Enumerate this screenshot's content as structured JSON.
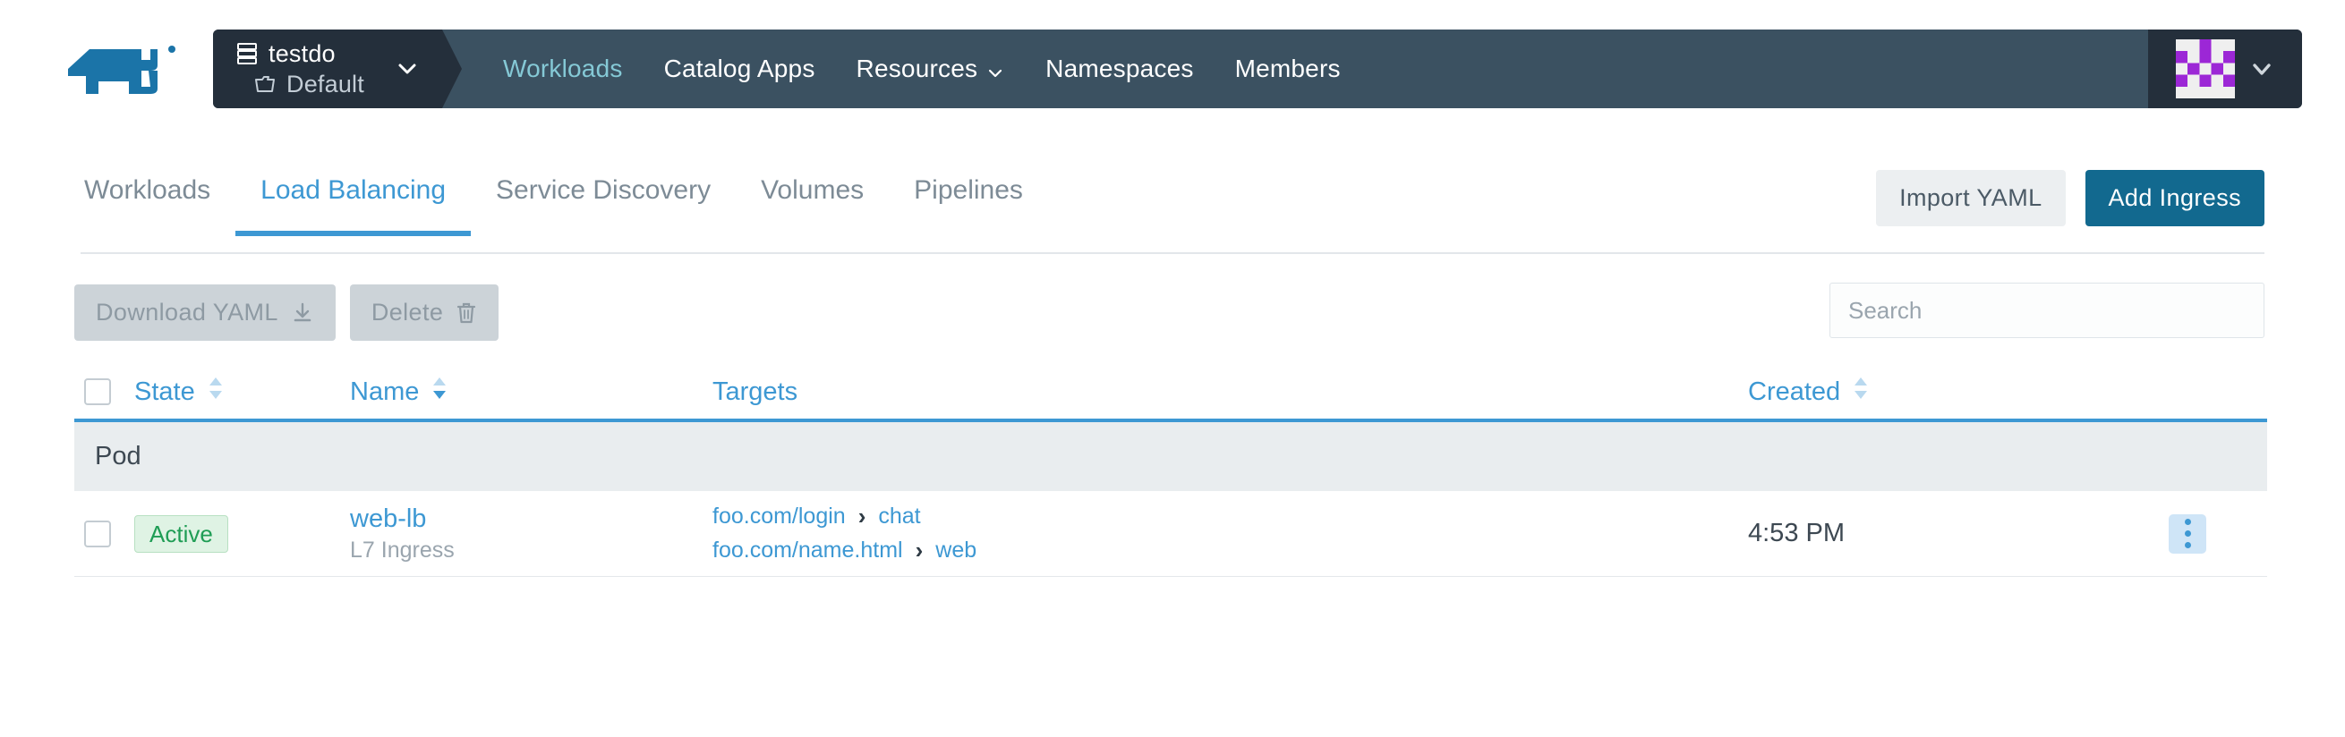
{
  "header": {
    "logo_icon": "rancher-cow-logo",
    "cluster": {
      "cluster_icon": "server-stack-icon",
      "cluster_name": "testdo",
      "project_icon": "folder-icon",
      "project_name": "Default",
      "caret_icon": "chevron-down-icon"
    },
    "nav": [
      {
        "label": "Workloads",
        "active": true,
        "has_caret": false
      },
      {
        "label": "Catalog Apps",
        "active": false,
        "has_caret": false
      },
      {
        "label": "Resources",
        "active": false,
        "has_caret": true
      },
      {
        "label": "Namespaces",
        "active": false,
        "has_caret": false
      },
      {
        "label": "Members",
        "active": false,
        "has_caret": false
      }
    ],
    "user": {
      "avatar_icon": "user-identicon-avatar",
      "caret_icon": "chevron-down-icon"
    }
  },
  "tabs": [
    {
      "label": "Workloads",
      "active": false
    },
    {
      "label": "Load Balancing",
      "active": true
    },
    {
      "label": "Service Discovery",
      "active": false
    },
    {
      "label": "Volumes",
      "active": false
    },
    {
      "label": "Pipelines",
      "active": false
    }
  ],
  "page_actions": {
    "import_yaml": "Import YAML",
    "add_ingress": "Add Ingress"
  },
  "toolbar": {
    "download_yaml": "Download YAML",
    "download_icon": "download-icon",
    "delete": "Delete",
    "delete_icon": "trash-icon",
    "search_placeholder": "Search",
    "search_value": ""
  },
  "table": {
    "columns": [
      {
        "label": "State",
        "sortable": true,
        "sort": "none"
      },
      {
        "label": "Name",
        "sortable": true,
        "sort": "desc"
      },
      {
        "label": "Targets",
        "sortable": false,
        "sort": "none"
      },
      {
        "label": "Created",
        "sortable": true,
        "sort": "none"
      }
    ],
    "group_label": "Pod",
    "rows": [
      {
        "selected": false,
        "state": "Active",
        "name": "web-lb",
        "name_sub": "L7 Ingress",
        "targets": [
          {
            "host": "foo.com/login",
            "separator": "›",
            "service": "chat"
          },
          {
            "host": "foo.com/name.html",
            "separator": "›",
            "service": "web"
          }
        ],
        "created": "4:53 PM",
        "menu_icon": "kebab-menu-icon"
      }
    ]
  },
  "colors": {
    "nav_bg": "#3b5161",
    "nav_dark": "#242f3b",
    "nav_active_text": "#85c9d6",
    "accent_blue": "#3d98d3",
    "primary_button": "#12698f",
    "brand_logo": "#1b74a8",
    "badge_green": "#1f9d55",
    "avatar_purple": "#9c27d6"
  }
}
